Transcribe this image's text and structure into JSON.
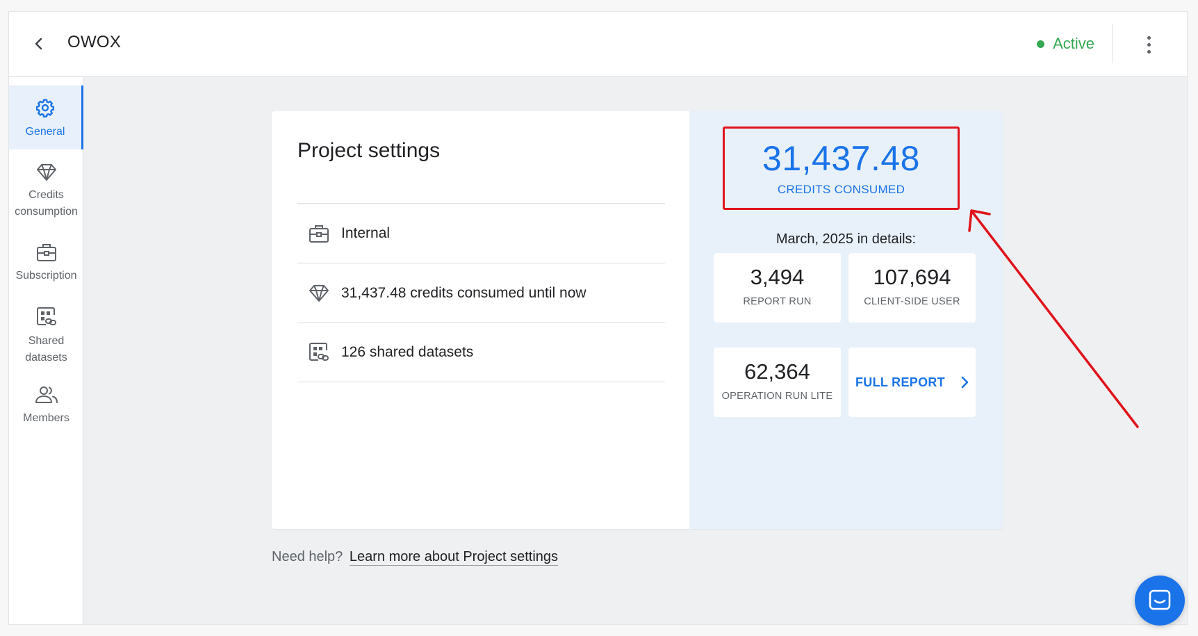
{
  "header": {
    "title": "OWOX",
    "status": "Active",
    "status_color": "#34a853"
  },
  "sidebar": {
    "items": [
      {
        "label": "General",
        "icon": "gear-icon",
        "active": true
      },
      {
        "label": "Credits consumption",
        "icon": "diamond-icon"
      },
      {
        "label": "Subscription",
        "icon": "briefcase-icon"
      },
      {
        "label": "Shared datasets",
        "icon": "shared-datasets-icon"
      },
      {
        "label": "Members",
        "icon": "members-icon"
      }
    ]
  },
  "project": {
    "title": "Project settings",
    "rows": [
      {
        "icon": "briefcase-icon",
        "text": "Internal"
      },
      {
        "icon": "diamond-icon",
        "text": "31,437.48 credits consumed until now"
      },
      {
        "icon": "shared-datasets-icon",
        "text": "126 shared datasets"
      }
    ]
  },
  "credits": {
    "value": "31,437.48",
    "label": "CREDITS CONSUMED",
    "month": "March, 2025 in details:",
    "stats": [
      {
        "value": "3,494",
        "label": "REPORT RUN"
      },
      {
        "value": "107,694",
        "label": "CLIENT-SIDE USER"
      },
      {
        "value": "62,364",
        "label": "OPERATION RUN LITE"
      }
    ],
    "full_report": "FULL REPORT"
  },
  "help": {
    "prefix": "Need help?",
    "link": "Learn more about Project settings"
  },
  "colors": {
    "accent": "#1a73e8",
    "highlight": "#e0131b",
    "panel": "#e8f1fa"
  }
}
